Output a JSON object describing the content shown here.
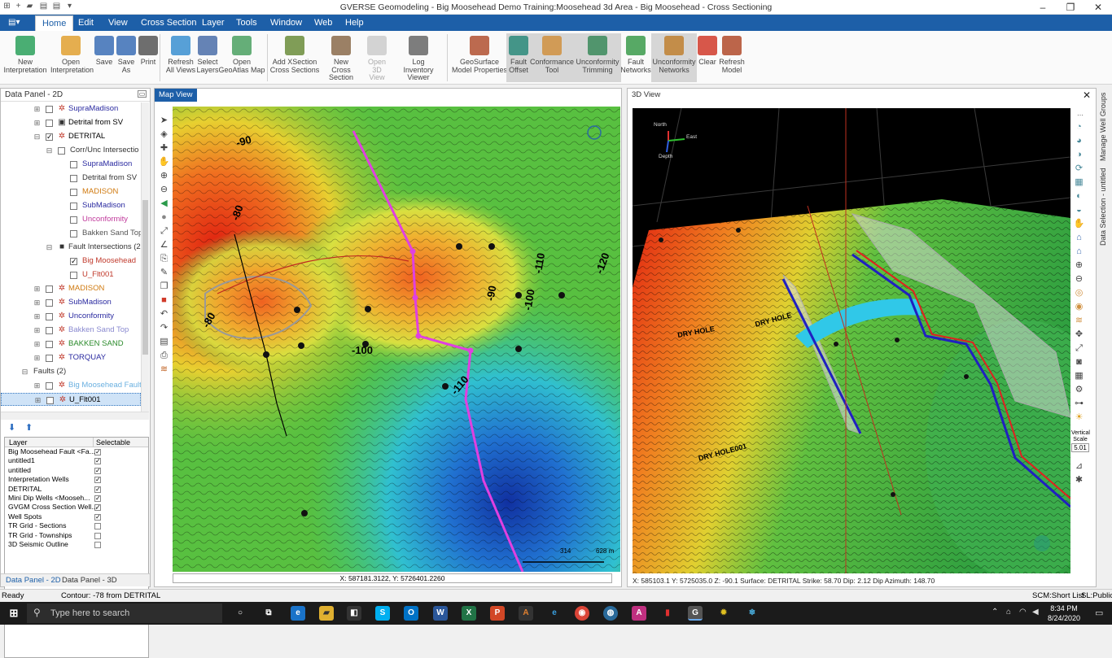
{
  "window": {
    "title": "GVERSE Geomodeling - Big Moosehead Demo Training:Moosehead 3d Area - Big Moosehead - Cross Sectioning",
    "minimize": "–",
    "maximize": "❐",
    "close": "✕"
  },
  "menu": {
    "items": [
      "Home",
      "Edit",
      "View",
      "Cross Section",
      "Layer",
      "Tools",
      "Window",
      "Web",
      "Help"
    ]
  },
  "ribbon": {
    "buttons": [
      {
        "label": "New\nInterpretation",
        "color": "#2aa05a"
      },
      {
        "label": "Open\nInterpretation",
        "color": "#e0a030"
      },
      {
        "label": "Save",
        "color": "#3a6db5"
      },
      {
        "label": "Save\nAs",
        "color": "#3a6db5"
      },
      {
        "label": "Print",
        "color": "#555"
      },
      {
        "label": "Refresh\nAll Views",
        "color": "#3a8fd0"
      },
      {
        "label": "Select\nLayers",
        "color": "#4a6da8"
      },
      {
        "label": "Open\nGeoAtlas Map",
        "color": "#4aa060"
      },
      {
        "label": "Add XSection\nCross Sections",
        "color": "#6a8c3a"
      },
      {
        "label": "New\nCross Section",
        "color": "#8a6a4a"
      },
      {
        "label": "Open\n3D View",
        "color": "#999"
      },
      {
        "label": "Log\nInventory Viewer",
        "color": "#666"
      },
      {
        "label": "GeoSurface\nModel Properties",
        "color": "#b05030"
      },
      {
        "label": "Fault\nOffset",
        "color": "#2a8a7a"
      },
      {
        "label": "Conformance\nTool",
        "color": "#d09040"
      },
      {
        "label": "Unconformity\nTrimming",
        "color": "#3a8a5a"
      },
      {
        "label": "Fault\nNetworks",
        "color": "#3a9a4a"
      },
      {
        "label": "Unconformity\nNetworks",
        "color": "#c08030"
      },
      {
        "label": "Clear",
        "color": "#d03a2a"
      },
      {
        "label": "Refresh\nModel",
        "color": "#b04a2a"
      }
    ]
  },
  "left_panel": {
    "title": "Data Panel - 2D",
    "tree": [
      {
        "label": "SupraMadison",
        "color": "#2a2aa0",
        "checked": false
      },
      {
        "label": "Detrital from SV",
        "color": "#000",
        "checked": false
      },
      {
        "label": "DETRITAL",
        "color": "#000",
        "checked": true
      },
      {
        "label": "Corr/Unc Intersectio",
        "color": "#333",
        "checked": false
      },
      {
        "label": "SupraMadison",
        "color": "#2a2aa0",
        "checked": false
      },
      {
        "label": "Detrital from SV",
        "color": "#333",
        "checked": false
      },
      {
        "label": "MADISON",
        "color": "#d07a10",
        "checked": false
      },
      {
        "label": "SubMadison",
        "color": "#2a2aa0",
        "checked": false
      },
      {
        "label": "Unconformity",
        "color": "#c0399b",
        "checked": false
      },
      {
        "label": "Bakken Sand Top",
        "color": "#555",
        "checked": false
      },
      {
        "label": "Fault Intersections (2",
        "color": "#333",
        "checked": false
      },
      {
        "label": "Big Moosehead",
        "color": "#c0392b",
        "checked": true
      },
      {
        "label": "U_Flt001",
        "color": "#c0392b",
        "checked": false
      },
      {
        "label": "MADISON",
        "color": "#d07a10",
        "checked": false
      },
      {
        "label": "SubMadison",
        "color": "#2a2aa0",
        "checked": false
      },
      {
        "label": "Unconformity",
        "color": "#2a2aa0",
        "checked": false
      },
      {
        "label": "Bakken Sand Top",
        "color": "#8a8ad0",
        "checked": false
      },
      {
        "label": "BAKKEN SAND",
        "color": "#2a8a2a",
        "checked": false
      },
      {
        "label": "TORQUAY",
        "color": "#2a2aa0",
        "checked": false
      },
      {
        "label": "Faults (2)",
        "color": "#333",
        "checked": false
      },
      {
        "label": "Big Moosehead Fault",
        "color": "#6ab0e0",
        "checked": false
      },
      {
        "label": "U_Flt001",
        "color": "#000",
        "checked": false
      }
    ],
    "layer_table": {
      "col_layer": "Layer",
      "col_selectable": "Selectable",
      "rows": [
        {
          "name": "Big Moosehead Fault <Fa...",
          "checked": true
        },
        {
          "name": "untitled1",
          "checked": true
        },
        {
          "name": "untitled",
          "checked": true
        },
        {
          "name": "Interpretation Wells",
          "checked": true
        },
        {
          "name": "DETRITAL",
          "checked": true
        },
        {
          "name": "Mini Dip Wells <Mooseh...",
          "checked": true
        },
        {
          "name": "GVGM Cross Section Well...",
          "checked": true
        },
        {
          "name": "Well Spots",
          "checked": true
        },
        {
          "name": "TR Grid - Sections",
          "checked": false
        },
        {
          "name": "TR Grid - Townships",
          "checked": false
        },
        {
          "name": "3D Seismic Outline",
          "checked": false
        }
      ]
    },
    "tabs": [
      "Data Panel - 2D",
      "Data Panel - 3D"
    ]
  },
  "map_view": {
    "tab": "Map View",
    "coords": "X: 587181.3122, Y: 5726401.2260",
    "contour_labels": [
      "-90",
      "-80",
      "-80",
      "-90",
      "-100",
      "-110",
      "-120",
      "-100",
      "-110"
    ],
    "scale_labels": [
      "314",
      "628 m"
    ]
  },
  "view3d": {
    "tab": "3D View",
    "axis_labels": [
      "North",
      "East",
      "Depth"
    ],
    "well_labels": [
      "DRY HOLE",
      "DRY HOLE",
      "DRY HOLE001"
    ],
    "vertical_scale_label": "Vertical\nScale",
    "vertical_scale_value": "5.01",
    "status": "X: 585103.1     Y: 5725035.0     Z: -90.1     Surface: DETRITAL     Strike: 58.70     Dip: 2.12     Dip Azimuth: 148.70"
  },
  "right_strip": {
    "tabs": [
      "Manage Well Groups",
      "Data Selection - untitled"
    ]
  },
  "statusbar": {
    "left": "Ready",
    "middle": "Contour: -78 from DETRITAL",
    "right1": "SCM:Short List",
    "right2": "SL:Public"
  },
  "taskbar": {
    "search_placeholder": "Type here to search",
    "time": "8:34 PM",
    "date": "8/24/2020"
  }
}
